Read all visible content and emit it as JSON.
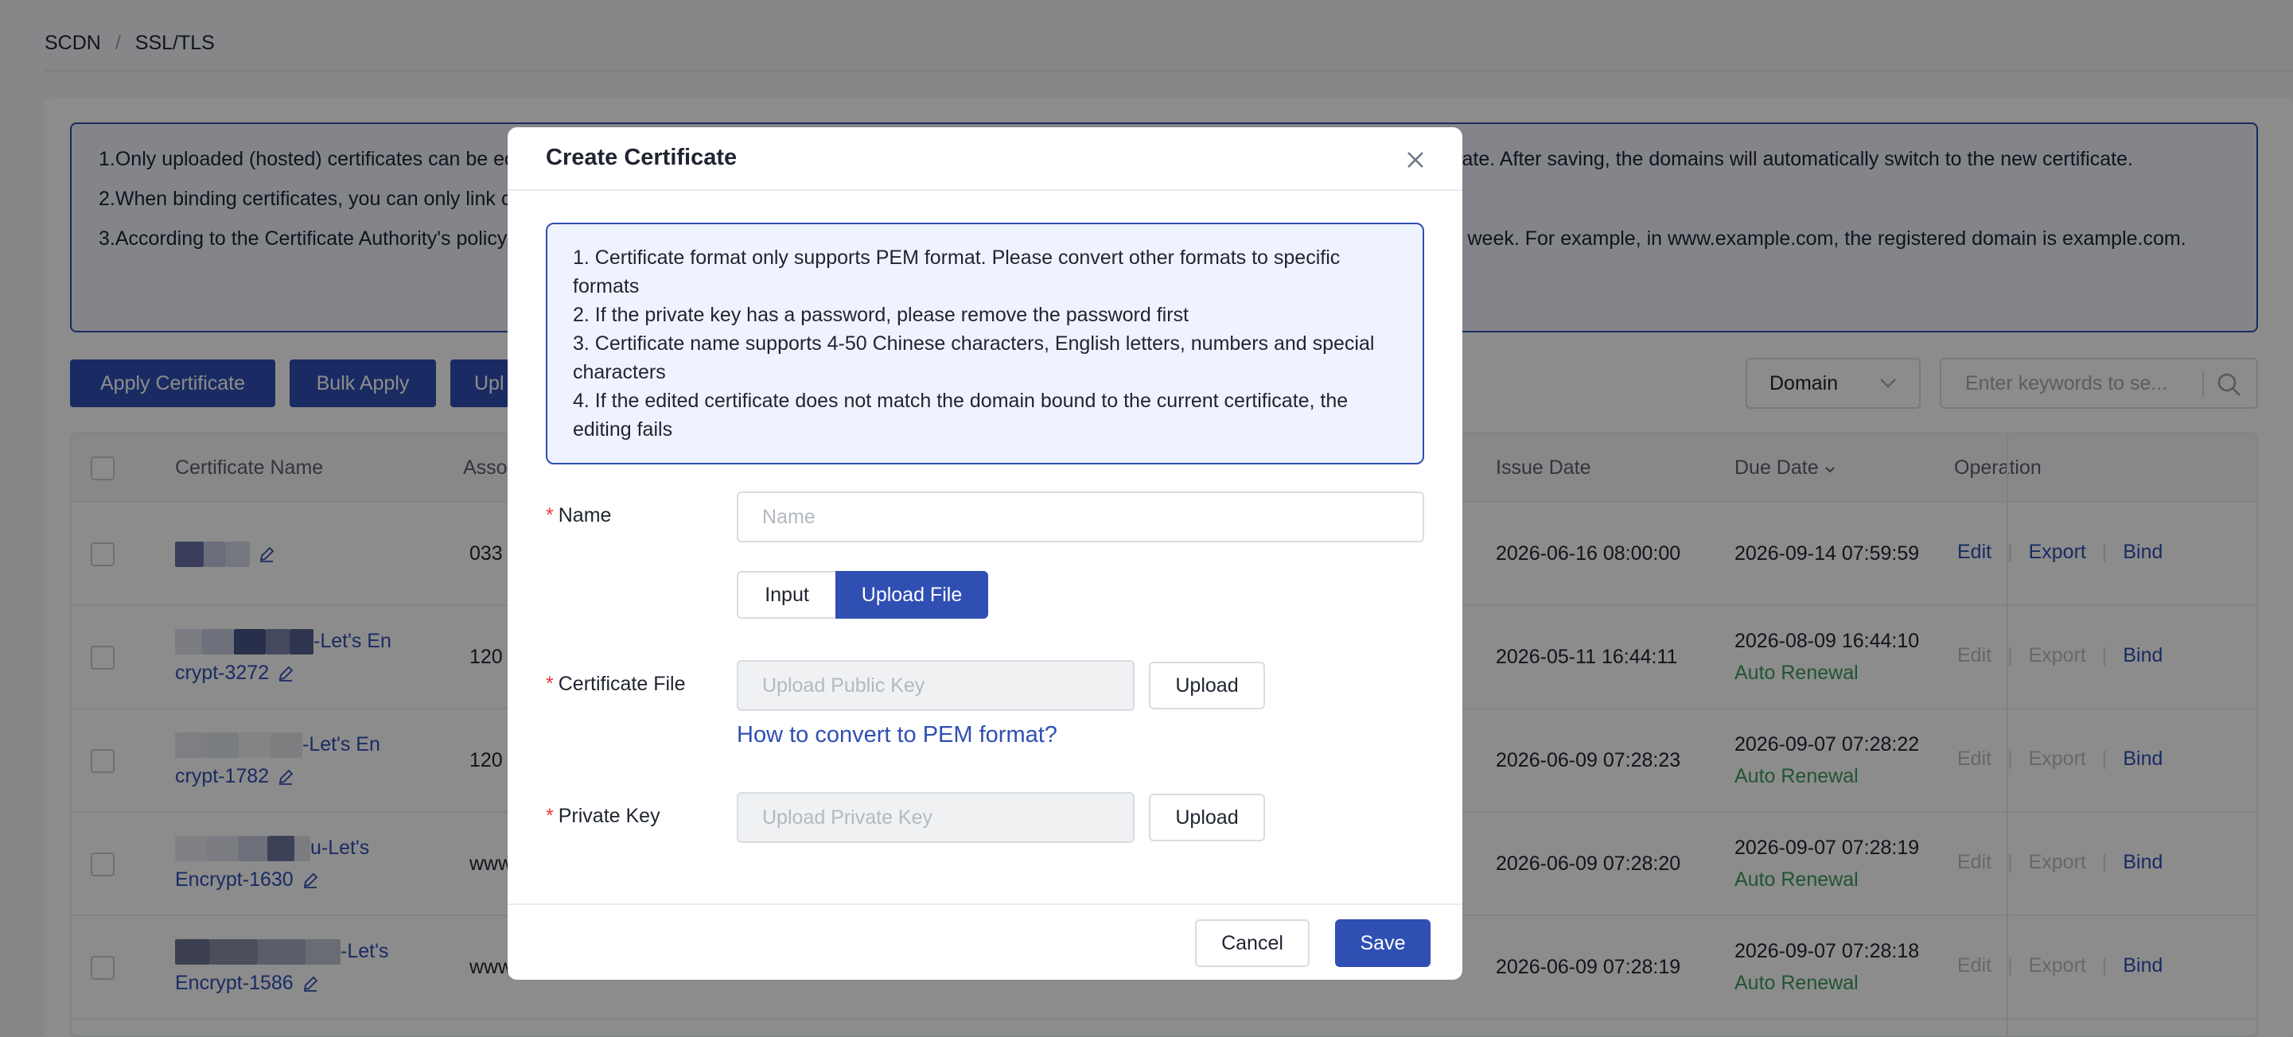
{
  "breadcrumb": {
    "root": "SCDN",
    "separator": "/",
    "current": "SSL/TLS"
  },
  "notice": {
    "line1": "1.Only uploaded (hosted) certificates can be edited. After editing the certificate, you need to upload the new certificate and private key of the original certificate. After saving, the domains will automatically switch to the new certificate.",
    "line2": "2.When binding certificates, you can only link certificates to domains that match the certificate.",
    "line3": "3.According to the Certificate Authority's policy, you can apply for up to 50 certificates per registered domain per week, and up to 5 duplicate certificates per week. For example, in www.example.com, the registered domain is example.com."
  },
  "toolbar": {
    "apply": "Apply Certificate",
    "bulk_apply": "Bulk Apply",
    "upload_partial": "Upl",
    "domain_select": "Domain",
    "search_placeholder": "Enter keywords to se..."
  },
  "table": {
    "headers": {
      "name": "Certificate Name",
      "assoc": "Asso",
      "issue_date": "Issue Date",
      "due_date": "Due Date",
      "operation": "Operation"
    },
    "ops": {
      "edit": "Edit",
      "export": "Export",
      "bind": "Bind",
      "sep": "|"
    },
    "auto_renewal": "Auto Renewal",
    "rows": [
      {
        "name1": "",
        "name2": "",
        "assoc": "033",
        "issue": "2026-06-16 08:00:00",
        "due": "2026-09-14 07:59:59",
        "auto": "",
        "active": true
      },
      {
        "name1": "-Let's En",
        "name2": "crypt-3272",
        "assoc": "120",
        "issue": "2026-05-11 16:44:11",
        "due": "2026-08-09 16:44:10",
        "auto": "Auto Renewal",
        "active": false
      },
      {
        "name1": "-Let's En",
        "name2": "crypt-1782",
        "assoc": "120",
        "issue": "2026-06-09 07:28:23",
        "due": "2026-09-07 07:28:22",
        "auto": "Auto Renewal",
        "active": false
      },
      {
        "name1": "u-Let's",
        "name2": "Encrypt-1630",
        "assoc": "www",
        "issue": "2026-06-09 07:28:20",
        "due": "2026-09-07 07:28:19",
        "auto": "Auto Renewal",
        "active": false
      },
      {
        "name1": "-Let's",
        "name2": "Encrypt-1586",
        "assoc": "www",
        "issue": "2026-06-09 07:28:19",
        "due": "2026-09-07 07:28:18",
        "auto": "Auto Renewal",
        "active": false
      }
    ]
  },
  "modal": {
    "title": "Create Certificate",
    "tips": [
      "1. Certificate format only supports PEM format. Please convert other formats to specific formats",
      "2. If the private key has a password, please remove the password first",
      "3. Certificate name supports 4-50 Chinese characters, English letters, numbers and special characters",
      "4. If the edited certificate does not match the domain bound to the current certificate, the editing fails"
    ],
    "required_mark": "*",
    "name_label": "Name",
    "name_placeholder": "Name",
    "mode_input": "Input",
    "mode_upload": "Upload File",
    "cert_file_label": "Certificate File",
    "cert_file_placeholder": "Upload Public Key",
    "upload": "Upload",
    "pem_link": "How to convert to PEM format?",
    "private_key_label": "Private Key",
    "private_key_placeholder": "Upload Private Key",
    "cancel": "Cancel",
    "save": "Save"
  },
  "colors": {
    "primary": "#2f4fb3",
    "success": "#3c9a5c",
    "required": "#e4393c",
    "tips_bg": "#eef3fd"
  }
}
